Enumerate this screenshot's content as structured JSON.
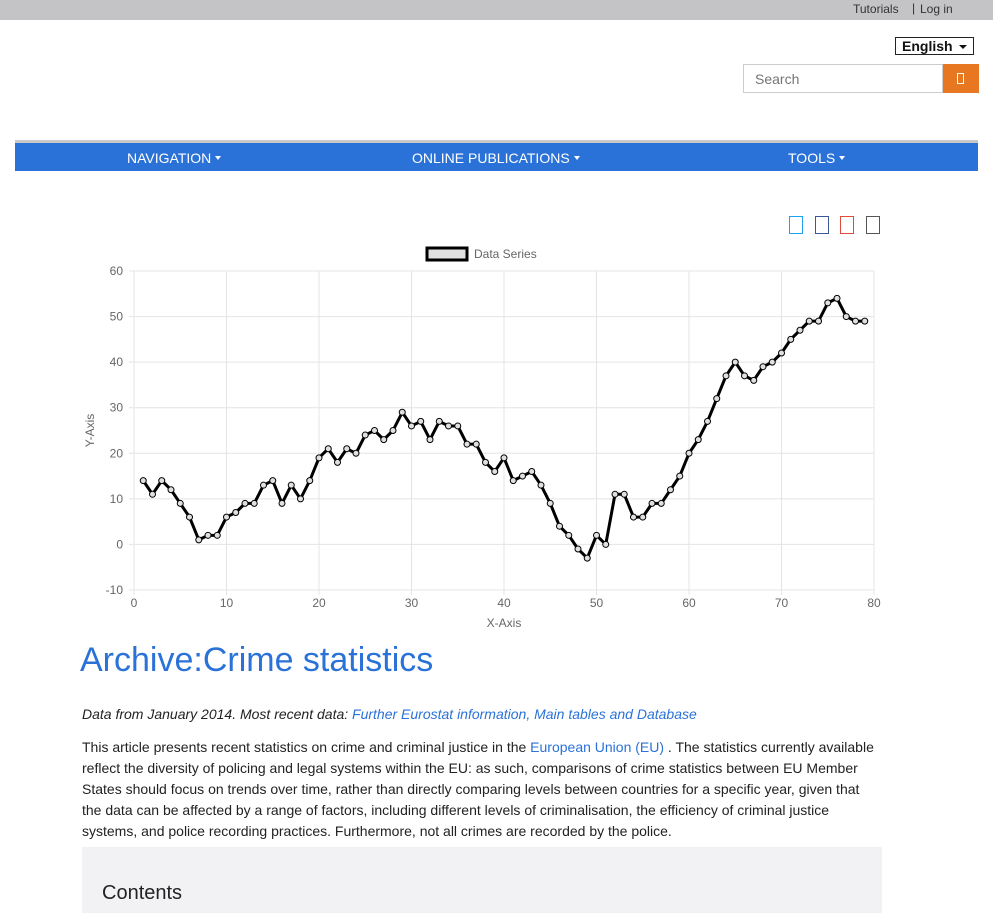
{
  "topbar": {
    "tutorials": "Tutorials",
    "separator": "|",
    "login": "Log in"
  },
  "language": {
    "selected": "English"
  },
  "search": {
    "placeholder": "Search",
    "button_icon": "search-icon"
  },
  "nav": {
    "items": [
      {
        "label": "NAVIGATION"
      },
      {
        "label": "ONLINE PUBLICATIONS"
      },
      {
        "label": "TOOLS"
      }
    ]
  },
  "share_icons": [
    {
      "icon": "twitter-icon",
      "color": "#1da1f2"
    },
    {
      "icon": "facebook-icon",
      "color": "#3b5998"
    },
    {
      "icon": "googleplus-icon",
      "color": "#dd4b39"
    },
    {
      "icon": "linkedin-icon",
      "color": "#555555"
    }
  ],
  "chart_data": {
    "type": "line",
    "legend": [
      "Data Series"
    ],
    "legend_position": "top",
    "xlabel": "X-Axis",
    "ylabel": "Y-Axis",
    "xlim": [
      0,
      80
    ],
    "ylim": [
      -10,
      60
    ],
    "xticks": [
      0,
      10,
      20,
      30,
      40,
      50,
      60,
      70,
      80
    ],
    "yticks": [
      -10,
      0,
      10,
      20,
      30,
      40,
      50,
      60
    ],
    "grid": true,
    "series": [
      {
        "name": "Data Series",
        "color": "#000000",
        "x": [
          1,
          2,
          3,
          4,
          5,
          6,
          7,
          8,
          9,
          10,
          11,
          12,
          13,
          14,
          15,
          16,
          17,
          18,
          19,
          20,
          21,
          22,
          23,
          24,
          25,
          26,
          27,
          28,
          29,
          30,
          31,
          32,
          33,
          34,
          35,
          36,
          37,
          38,
          39,
          40,
          41,
          42,
          43,
          44,
          45,
          46,
          47,
          48,
          49,
          50,
          51,
          52,
          53,
          54,
          55,
          56,
          57,
          58,
          59,
          60,
          61,
          62,
          63,
          64,
          65,
          66,
          67,
          68,
          69,
          70,
          71,
          72,
          73,
          74,
          75,
          76,
          77,
          78,
          79
        ],
        "y": [
          14,
          11,
          14,
          12,
          9,
          6,
          1,
          2,
          2,
          6,
          7,
          9,
          9,
          13,
          14,
          9,
          13,
          10,
          14,
          19,
          21,
          18,
          21,
          20,
          24,
          25,
          23,
          25,
          29,
          26,
          27,
          23,
          27,
          26,
          26,
          22,
          22,
          18,
          16,
          19,
          14,
          15,
          16,
          13,
          9,
          4,
          2,
          -1,
          -3,
          2,
          0,
          11,
          11,
          6,
          6,
          9,
          9,
          12,
          15,
          20,
          23,
          27,
          32,
          37,
          40,
          37,
          36,
          39,
          40,
          42,
          45,
          47,
          49,
          49,
          53,
          54,
          50,
          49,
          49
        ]
      }
    ]
  },
  "article": {
    "title": "Archive:Crime statistics",
    "note_prefix": "Data from January 2014. Most recent data: ",
    "note_link": "Further Eurostat information, Main tables and Database",
    "para_1": "This article presents recent statistics on crime and criminal justice in the ",
    "para_link": "European Union (EU)",
    "para_2": "     . The statistics currently available reflect the diversity of policing and legal systems within the EU: as such, comparisons of crime statistics between EU Member States should focus on trends over time, rather than directly comparing levels between countries for a specific year, given that the data can be affected by a range of factors, including different levels of criminalisation, the efficiency of criminal justice systems, and police recording practices. Furthermore, not all crimes are recorded by the police."
  },
  "toc": {
    "heading": "Contents"
  }
}
